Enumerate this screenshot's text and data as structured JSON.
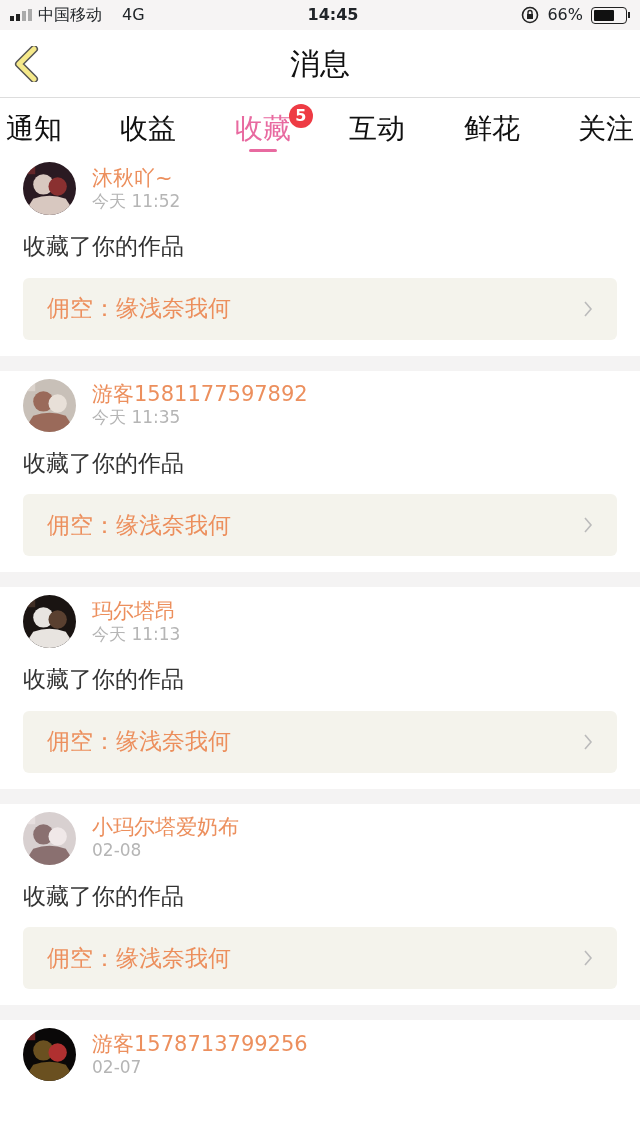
{
  "status_bar": {
    "carrier": "中国移动",
    "network": "4G",
    "time": "14:45",
    "battery": "66%"
  },
  "header": {
    "title": "消息"
  },
  "tabs": [
    {
      "label": "通知",
      "selected": false
    },
    {
      "label": "收益",
      "selected": false
    },
    {
      "label": "收藏",
      "selected": true,
      "badge": "5"
    },
    {
      "label": "互动",
      "selected": false
    },
    {
      "label": "鲜花",
      "selected": false
    },
    {
      "label": "关注",
      "selected": false
    }
  ],
  "messages": [
    {
      "user": "沐秋吖~",
      "time": "今天 11:52",
      "action": "收藏了你的作品",
      "work": "佣空：缘浅奈我何"
    },
    {
      "user": "游客1581177597892",
      "time": "今天 11:35",
      "action": "收藏了你的作品",
      "work": "佣空：缘浅奈我何"
    },
    {
      "user": "玛尔塔昂",
      "time": "今天 11:13",
      "action": "收藏了你的作品",
      "work": "佣空：缘浅奈我何"
    },
    {
      "user": "小玛尔塔爱奶布",
      "time": "02-08",
      "action": "收藏了你的作品",
      "work": "佣空：缘浅奈我何"
    },
    {
      "user": "游客1578713799256",
      "time": "02-07"
    }
  ]
}
